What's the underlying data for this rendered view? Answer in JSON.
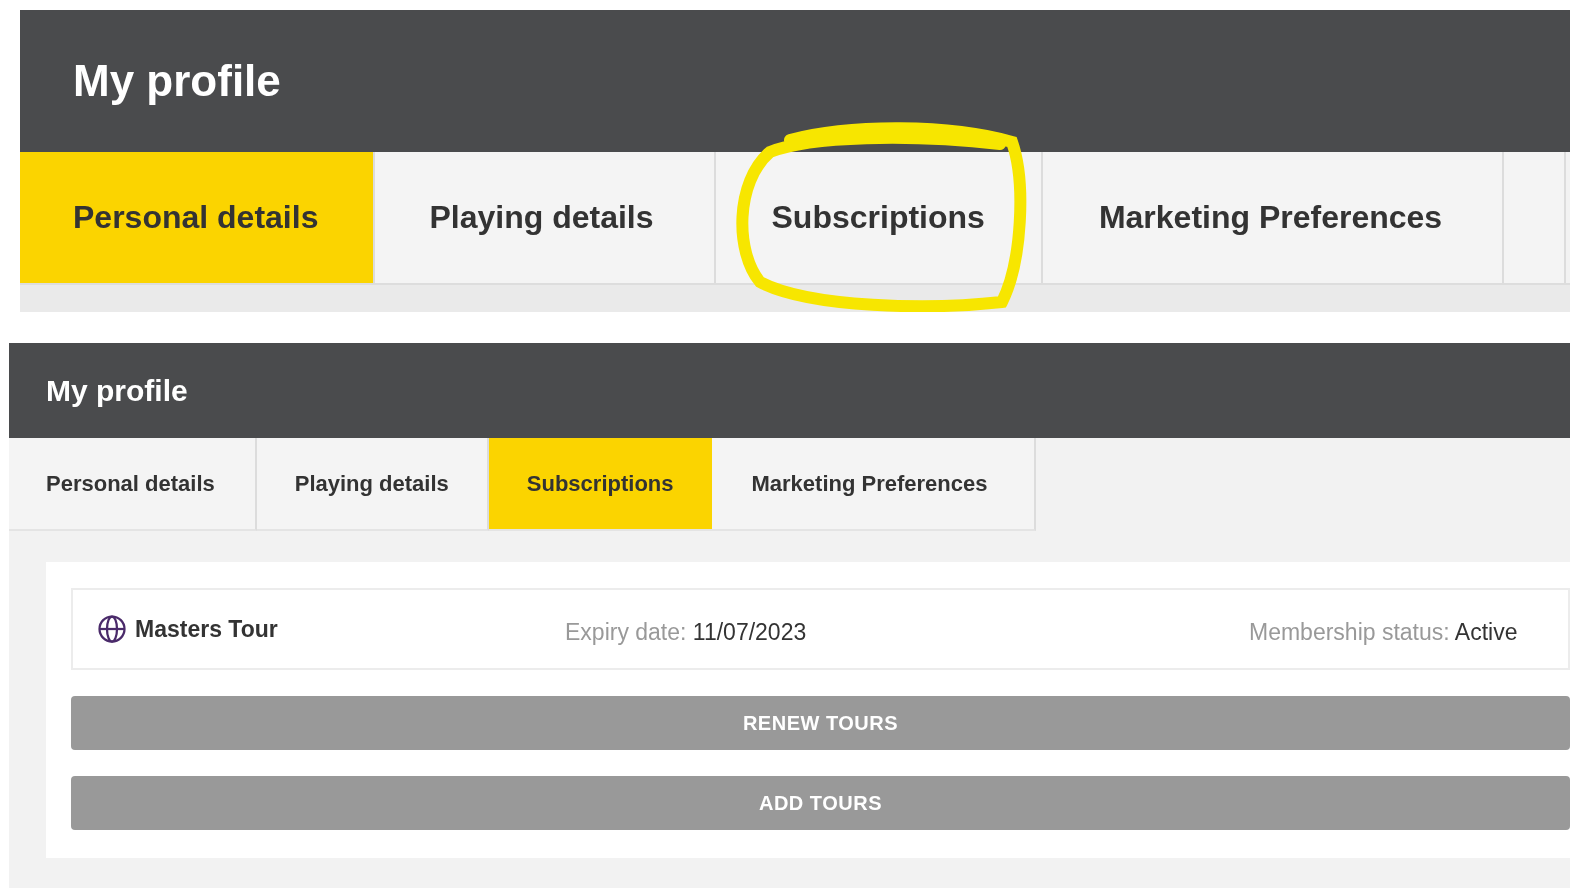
{
  "panels": [
    {
      "title": "My profile",
      "kind": "large",
      "tabs": [
        {
          "label": "Personal details",
          "selected": true
        },
        {
          "label": "Playing details",
          "selected": false
        },
        {
          "label": "Subscriptions",
          "selected": false,
          "circled": true
        },
        {
          "label": "Marketing Preferences",
          "selected": false
        }
      ]
    },
    {
      "title": "My profile",
      "kind": "small",
      "tabs": [
        {
          "label": "Personal details",
          "selected": false
        },
        {
          "label": "Playing details",
          "selected": false
        },
        {
          "label": "Subscriptions",
          "selected": true
        },
        {
          "label": "Marketing Preferences",
          "selected": false
        }
      ],
      "subscription": {
        "name": "Masters Tour",
        "expiry_label": "Expiry date:",
        "expiry_value": "11/07/2023",
        "status_label": "Membership status:",
        "status_value": "Active"
      },
      "buttons": [
        "RENEW TOURS",
        "ADD TOURS"
      ]
    }
  ]
}
